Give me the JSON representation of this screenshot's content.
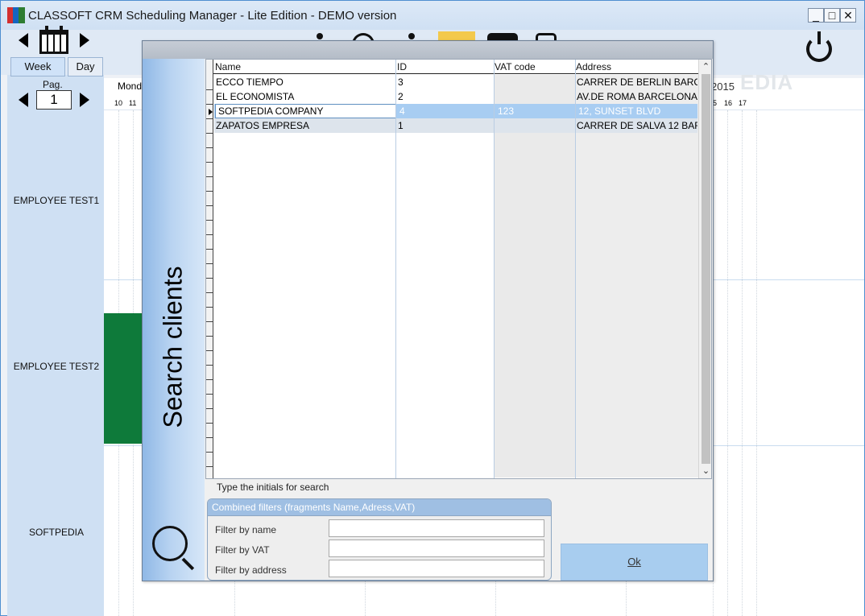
{
  "window": {
    "title": "CLASSOFT CRM Scheduling Manager  - Lite Edition  - DEMO version",
    "minimize": "_",
    "maximize": "□",
    "close": "✕"
  },
  "left_panel": {
    "tabs": [
      {
        "label": "Week"
      },
      {
        "label": "Day"
      }
    ],
    "pag_label": "Pag.",
    "pag_value": "1",
    "employees": [
      {
        "label": "EMPLOYEE TEST1"
      },
      {
        "label": "EMPLOYEE TEST2"
      },
      {
        "label": "SOFTPEDIA"
      }
    ]
  },
  "schedule": {
    "day_prefix": "Mond",
    "hours_left": [
      "10",
      "11"
    ],
    "hours_right": [
      "5",
      "16",
      "17"
    ],
    "year_fragment": "2015",
    "watermark": "EDIA"
  },
  "dialog": {
    "side_title": "Search clients",
    "columns": [
      "Name",
      "ID",
      "VAT code",
      "Address"
    ],
    "rows": [
      {
        "name": "ECCO TIEMPO",
        "id": "3",
        "vat": "",
        "address": "CARRER DE BERLIN BARC"
      },
      {
        "name": "EL ECONOMISTA",
        "id": "2",
        "vat": "",
        "address": "AV.DE ROMA BARCELONA"
      },
      {
        "name": "SOFTPEDIA COMPANY",
        "id": "4",
        "vat": "123",
        "address": "12, SUNSET BLVD"
      },
      {
        "name": "ZAPATOS EMPRESA",
        "id": "1",
        "vat": "",
        "address": "CARRER DE SALVA 12 BAR"
      }
    ],
    "hint": "Type the initials for search",
    "filters_title": "Combined filters (fragments Name,Adress,VAT)",
    "filter_name_label": "Filter by name",
    "filter_vat_label": "Filter by VAT",
    "filter_address_label": "Filter by address",
    "filter_name_value": "",
    "filter_vat_value": "",
    "filter_address_value": "",
    "ok_label": "Ok"
  },
  "colors": {
    "selected_row": "#a8cdf2",
    "ok_button": "#a8cdef",
    "green_block": "#0e7a3a",
    "filters_header": "#9fbfe3"
  }
}
